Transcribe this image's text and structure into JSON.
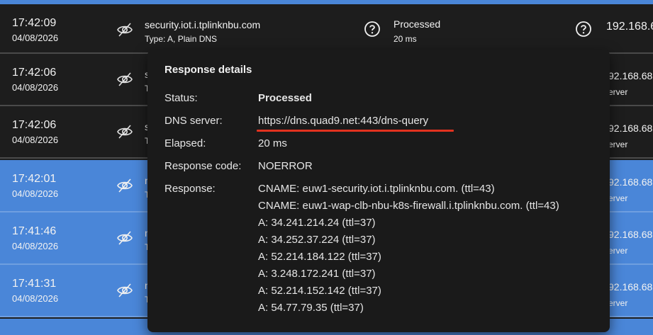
{
  "rows": [
    {
      "time": "17:42:09",
      "date": "04/08/2026",
      "domain": "security.iot.i.tplinknbu.com",
      "type": "Type: A, Plain DNS",
      "status": "Processed",
      "elapsed": "20 ms",
      "ip": "192.168.6",
      "ip_sub": ""
    },
    {
      "time": "17:42:06",
      "date": "04/08/2026",
      "domain": "s",
      "type": "T",
      "status": "",
      "elapsed": "",
      "ip": "92.168.68",
      "ip_sub": "erver"
    },
    {
      "time": "17:42:06",
      "date": "04/08/2026",
      "domain": "s",
      "type": "T",
      "status": "",
      "elapsed": "",
      "ip": "92.168.68",
      "ip_sub": "erver"
    },
    {
      "time": "17:42:01",
      "date": "04/08/2026",
      "domain": "n",
      "type": "T",
      "status": "",
      "elapsed": "",
      "ip": "92.168.68",
      "ip_sub": "erver"
    },
    {
      "time": "17:41:46",
      "date": "04/08/2026",
      "domain": "n",
      "type": "T",
      "status": "",
      "elapsed": "",
      "ip": "92.168.68",
      "ip_sub": "erver"
    },
    {
      "time": "17:41:31",
      "date": "04/08/2026",
      "domain": "n",
      "type": "T",
      "status": "",
      "elapsed": "",
      "ip": "92.168.68",
      "ip_sub": "erver"
    }
  ],
  "popup": {
    "title": "Response details",
    "status_label": "Status:",
    "status_value": "Processed",
    "dns_label": "DNS server:",
    "dns_value": "https://dns.quad9.net:443/dns-query",
    "elapsed_label": "Elapsed:",
    "elapsed_value": "20 ms",
    "code_label": "Response code:",
    "code_value": "NOERROR",
    "response_label": "Response:",
    "response_lines": [
      "CNAME: euw1-security.iot.i.tplinknbu.com. (ttl=43)",
      "CNAME: euw1-wap-clb-nbu-k8s-firewall.i.tplinknbu.com. (ttl=43)",
      "A: 34.241.214.24 (ttl=37)",
      "A: 34.252.37.224 (ttl=37)",
      "A: 52.214.184.122 (ttl=37)",
      "A: 3.248.172.241 (ttl=37)",
      "A: 52.214.152.142 (ttl=37)",
      "A: 54.77.79.35 (ttl=37)"
    ]
  },
  "icons": {
    "hide": "eye-slash-icon",
    "help": "question-circle-icon"
  },
  "colors": {
    "accent": "#4a86d8",
    "highlight": "#e3321f",
    "row_dark": "#1d1d1d"
  }
}
